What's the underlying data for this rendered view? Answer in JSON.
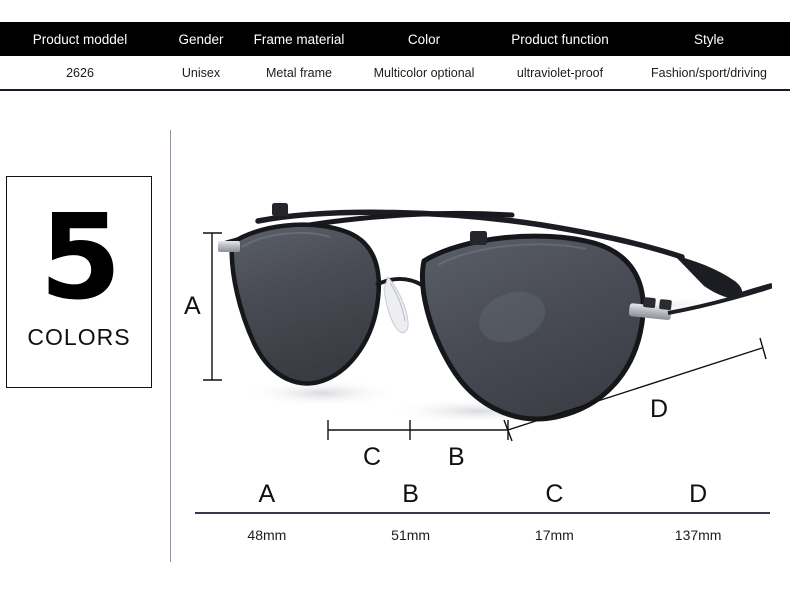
{
  "spec_table": {
    "headers": [
      "Product moddel",
      "Gender",
      "Frame material",
      "Color",
      "Product function",
      "Style"
    ],
    "values": [
      "2626",
      "Unisex",
      "Metal frame",
      "Multicolor optional",
      "ultraviolet-proof",
      "Fashion/sport/driving"
    ],
    "header_bg": "#000000",
    "header_text_color": "#ffffff",
    "rule_color": "#141b2c"
  },
  "colors_badge": {
    "count": "5",
    "label": "COLORS",
    "border_color": "#111111"
  },
  "product": {
    "name": "sunglasses-photo",
    "lens_color": "#4a4d55",
    "frame_color": "#16181c",
    "metal_accent_color": "#b9bcc2"
  },
  "dimensions": {
    "a_letter": "A",
    "b_letter": "B",
    "c_letter": "C",
    "d_letter": "D"
  },
  "legend": {
    "letters": [
      "A",
      "B",
      "C",
      "D"
    ],
    "values": [
      "48mm",
      "51mm",
      "17mm",
      "137mm"
    ],
    "rule_color": "#333b4a"
  },
  "guide": {
    "color": "#8a97ad"
  }
}
